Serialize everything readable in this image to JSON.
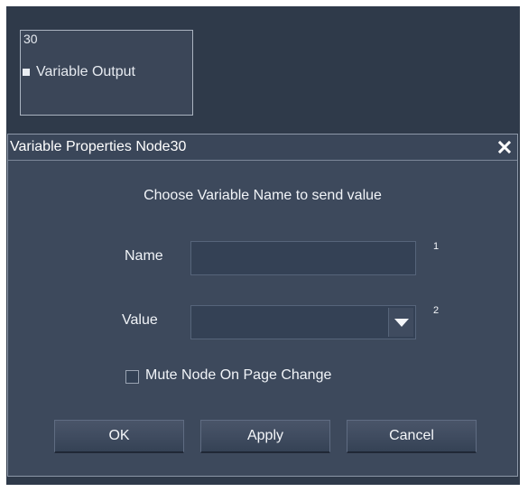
{
  "node": {
    "id": "30",
    "label": "Variable Output",
    "port_icon": "port-square-icon"
  },
  "dialog": {
    "title": "Variable Properties Node30",
    "close_icon": "close-icon",
    "prompt": "Choose Variable Name to send value",
    "name_label": "Name",
    "name_value": "",
    "name_marker": "1",
    "value_label": "Value",
    "value_selected": "",
    "value_marker": "2",
    "dropdown_icon": "chevron-down-icon",
    "mute_label": "Mute Node On Page Change",
    "mute_checked": false,
    "ok_label": "OK",
    "apply_label": "Apply",
    "cancel_label": "Cancel"
  },
  "colors": {
    "canvas": "#2f3a4a",
    "dialog": "#3d495c",
    "field": "#344155",
    "text": "#f1f4f8"
  }
}
